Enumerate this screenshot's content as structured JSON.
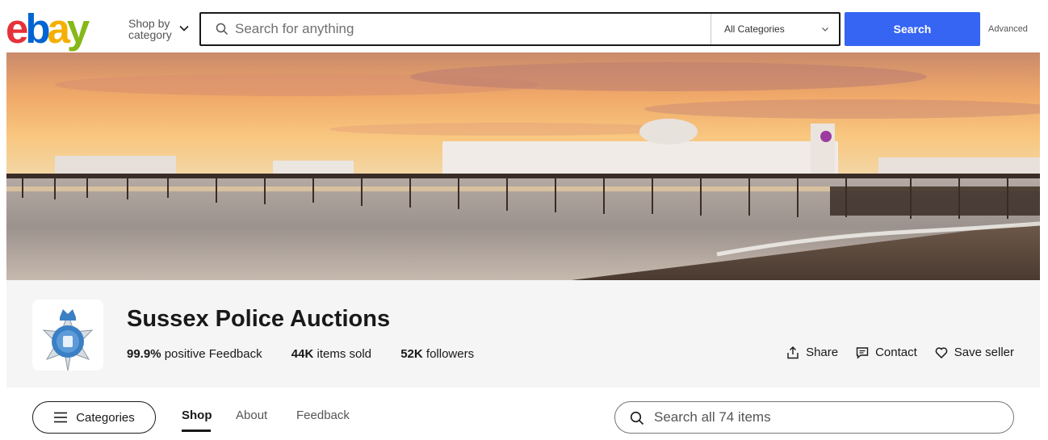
{
  "header": {
    "logo_letters": [
      "e",
      "b",
      "a",
      "y"
    ],
    "logo_colors": [
      "#e53238",
      "#0064d2",
      "#f5af02",
      "#86b817"
    ],
    "shop_by_line1": "Shop by",
    "shop_by_line2": "category",
    "search_placeholder": "Search for anything",
    "category_selected": "All Categories",
    "search_button": "Search",
    "advanced_link": "Advanced"
  },
  "seller": {
    "name": "Sussex Police Auctions",
    "feedback_pct": "99.9%",
    "feedback_label": "positive Feedback",
    "items_sold_count": "44K",
    "items_sold_label": "items sold",
    "followers_count": "52K",
    "followers_label": "followers",
    "actions": {
      "share": "Share",
      "contact": "Contact",
      "save": "Save seller"
    }
  },
  "nav": {
    "categories_label": "Categories",
    "tabs": [
      "Shop",
      "About",
      "Feedback"
    ],
    "active_tab": "Shop",
    "store_search_placeholder": "Search all 74 items"
  },
  "colors": {
    "accent": "#3665f3",
    "text": "#191919",
    "panel_bg": "#f5f5f5"
  }
}
